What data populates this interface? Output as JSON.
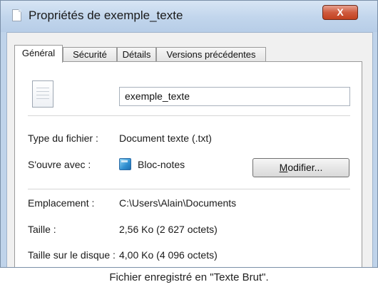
{
  "window": {
    "title": "Propriétés de exemple_texte",
    "close_label": "X"
  },
  "tabs": [
    {
      "label": "Général",
      "active": true
    },
    {
      "label": "Sécurité",
      "active": false
    },
    {
      "label": "Détails",
      "active": false
    },
    {
      "label": "Versions précédentes",
      "active": false
    }
  ],
  "general": {
    "file_icon": "text-document-icon",
    "file_name": "exemple_texte",
    "file_type_label": "Type du fichier :",
    "file_type_value": "Document texte (.txt)",
    "opens_with_label": "S'ouvre avec :",
    "opens_with_app_icon": "notepad-icon",
    "opens_with_value": "Bloc-notes",
    "modify_button_first": "M",
    "modify_button_rest": "odifier...",
    "location_label": "Emplacement :",
    "location_value": "C:\\Users\\Alain\\Documents",
    "size_label": "Taille :",
    "size_value": "2,56 Ko (2 627 octets)",
    "disk_size_label": "Taille sur le disque :",
    "disk_size_value": "4,00 Ko (4 096 octets)"
  },
  "caption": "Fichier enregistré en \"Texte Brut\"."
}
